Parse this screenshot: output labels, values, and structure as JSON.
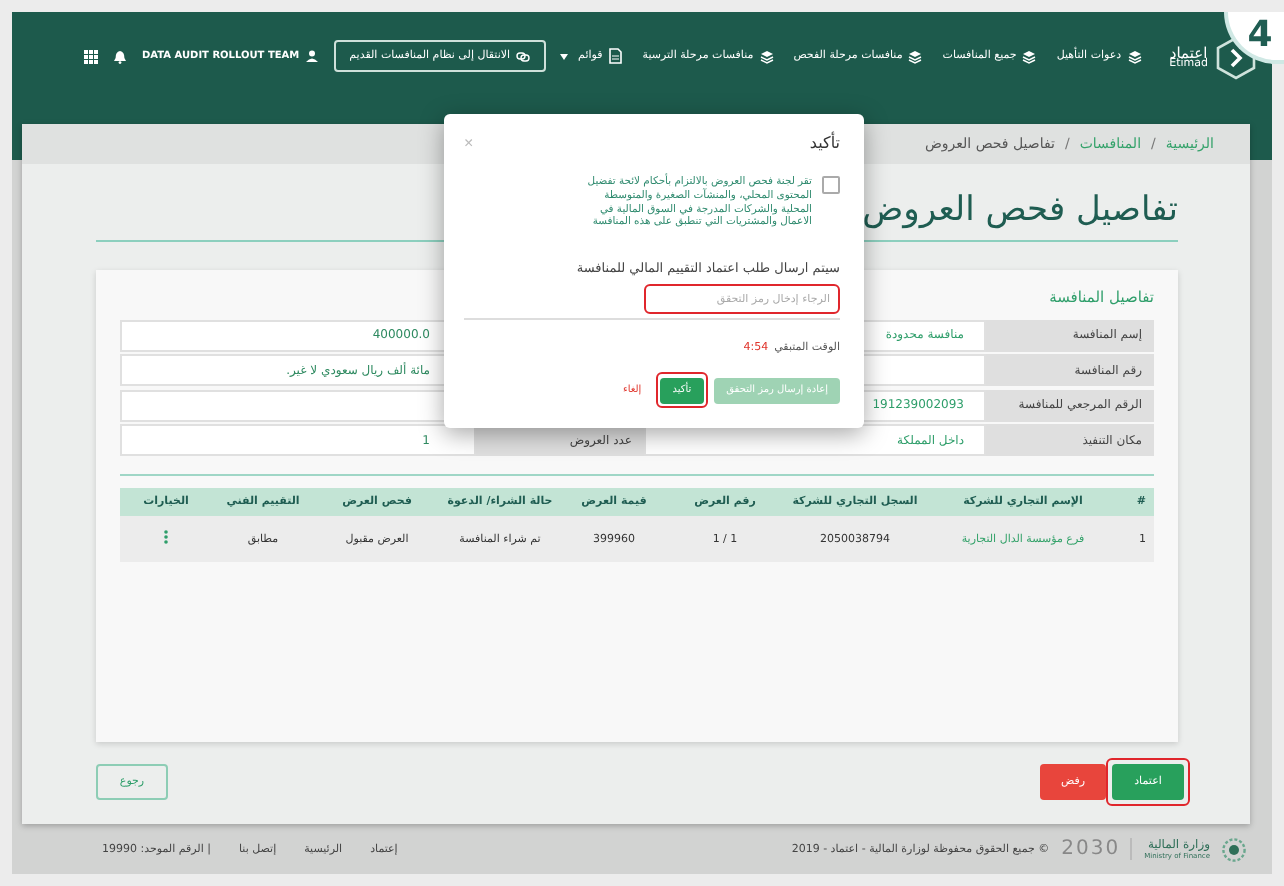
{
  "step_badge": "4",
  "header": {
    "logo": {
      "arabic": "اعتماد",
      "latin": "Etimad"
    },
    "nav": [
      {
        "label": "دعوات التأهيل",
        "kind": "link"
      },
      {
        "label": "جميع المنافسات",
        "kind": "link"
      },
      {
        "label": "منافسات مرحلة الفحص",
        "kind": "link"
      },
      {
        "label": "منافسات مرحلة الترسية",
        "kind": "link"
      },
      {
        "label": "قوائم",
        "kind": "menu"
      }
    ],
    "old_system_button": "الانتقال إلى نظام المنافسات القديم",
    "user": "DATA AUDIT ROLLOUT TEAM"
  },
  "breadcrumb": [
    {
      "label": "الرئيسية",
      "kind": "link"
    },
    {
      "label": "/",
      "kind": "separator"
    },
    {
      "label": "المنافسات",
      "kind": "link"
    },
    {
      "label": "/",
      "kind": "separator"
    },
    {
      "label": "تفاصيل فحص العروض",
      "kind": "current"
    }
  ],
  "page_title": "تفاصيل فحص العروض",
  "details": {
    "title": "تفاصيل المنافسة",
    "rows": [
      {
        "label": "إسم المنافسة",
        "value": "منافسة محدودة",
        "value_2": "400000.0"
      },
      {
        "label": "رقم المنافسة",
        "value_2": "مائة ألف ريال سعودي لا غير."
      },
      {
        "label": "الرقم المرجعي للمنافسة",
        "value": "191239002093"
      },
      {
        "label": "مكان التنفيذ",
        "value": "داخل المملكة",
        "label_2": "عدد العروض",
        "value_2": "1"
      }
    ]
  },
  "table": {
    "columns": [
      "#",
      "الإسم التجاري للشركة",
      "السجل التجاري للشركة",
      "رقم العرض",
      "قيمة العرض",
      "حالة الشراء/ الدعوة",
      "فحص العرض",
      "التقييم الفني",
      "الخيارات"
    ],
    "rows": [
      {
        "cells": [
          {
            "text": "1",
            "kind": "text"
          },
          {
            "text": "فرع مؤسسة الدال التجارية",
            "kind": "link"
          },
          {
            "text": "2050038794",
            "kind": "text"
          },
          {
            "text": "1 / 1",
            "kind": "text"
          },
          {
            "text": "399960",
            "kind": "text"
          },
          {
            "text": "تم شراء المنافسة",
            "kind": "text"
          },
          {
            "text": "العرض مقبول",
            "kind": "text"
          },
          {
            "text": "مطابق",
            "kind": "text"
          },
          {
            "kind": "options"
          }
        ]
      }
    ]
  },
  "actions": {
    "approve": {
      "label": "اعتماد",
      "highlighted": true
    },
    "reject": {
      "label": "رفض"
    },
    "back": {
      "label": "رجوع"
    }
  },
  "modal": {
    "title": "تأكيد",
    "close": "×",
    "checkbox": {
      "checked": false,
      "text": "تقر لجنة فحص العروض بالالتزام بأحكام لائحة تفضيل المحتوى المحلي، والمنشآت الصغيرة والمتوسطة المحلية والشركات المدرجة في السوق المالية في الاعمال والمشتريات التي تنطبق على هذه المنافسة"
    },
    "message": "سيتم ارسال طلب اعتماد التقييم المالي للمنافسة",
    "code_field": {
      "placeholder": "الرجاء إدخال رمز التحقق",
      "highlighted": true
    },
    "time_label": "الوقت المتبقي",
    "time_value": "4:54",
    "buttons": [
      {
        "label": "إعادة إرسال رمز التحقق",
        "kind": "primary",
        "disabled": true
      },
      {
        "label": "تأكيد",
        "kind": "primary",
        "disabled": false,
        "highlighted": true
      },
      {
        "label": "إلغاء",
        "kind": "link"
      }
    ]
  },
  "footer": {
    "ministry": {
      "arabic": "وزارة المالية",
      "english": "Ministry of Finance"
    },
    "vision": "2030",
    "copyright": "© جميع الحقوق محفوظة لوزارة المالية - اعتماد - 2019",
    "links": [
      "إعتماد",
      "الرئيسية",
      "إتصل بنا"
    ],
    "unified_number": "| الرقم الموحد: 19990"
  }
}
